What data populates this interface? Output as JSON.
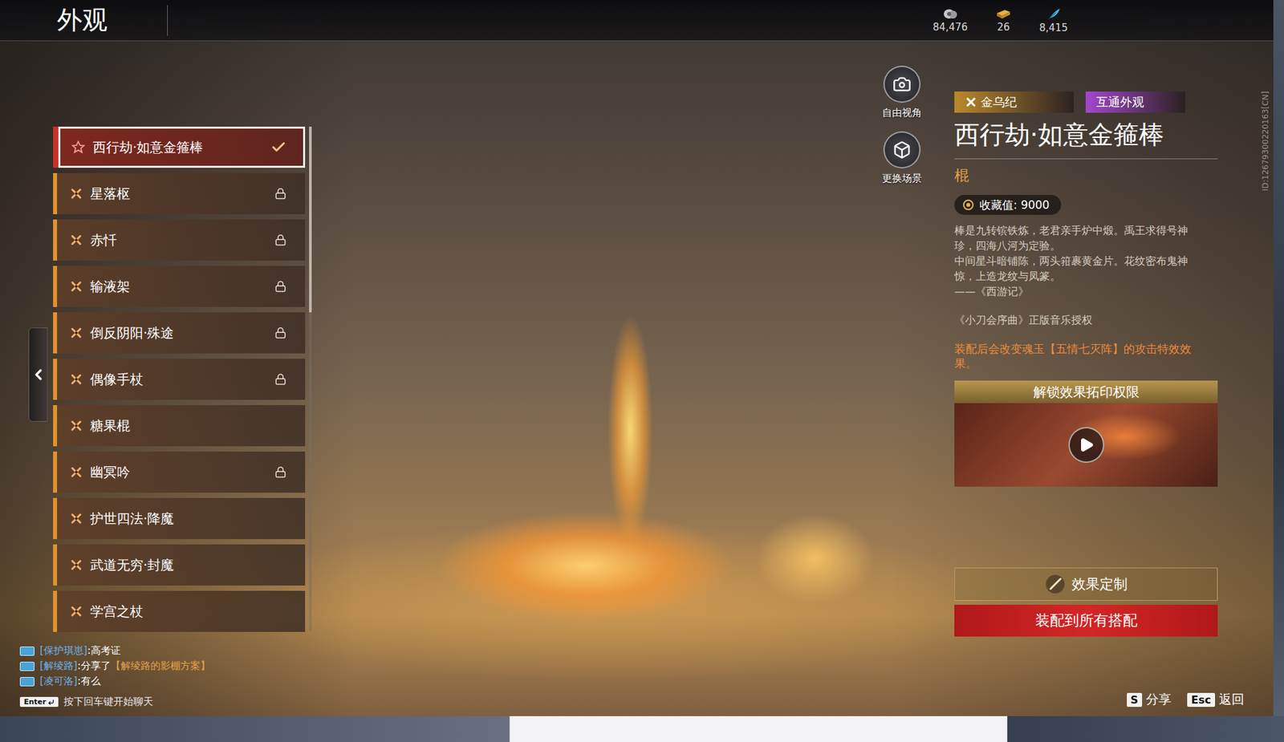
{
  "header": {
    "title": "外观",
    "currencies": [
      {
        "kind": "coin",
        "value": "84,476"
      },
      {
        "kind": "ticket",
        "value": "26"
      },
      {
        "kind": "feather",
        "value": "8,415"
      }
    ]
  },
  "skins": [
    {
      "name": "西行劫·如意金箍棒",
      "selected": true,
      "locked": false
    },
    {
      "name": "星落枢",
      "selected": false,
      "locked": true
    },
    {
      "name": "赤忏",
      "selected": false,
      "locked": true
    },
    {
      "name": "输液架",
      "selected": false,
      "locked": true
    },
    {
      "name": "倒反阴阳·殊途",
      "selected": false,
      "locked": true
    },
    {
      "name": "偶像手杖",
      "selected": false,
      "locked": true
    },
    {
      "name": "糖果棍",
      "selected": false,
      "locked": false
    },
    {
      "name": "幽冥吟",
      "selected": false,
      "locked": true
    },
    {
      "name": "护世四法·降魔",
      "selected": false,
      "locked": false
    },
    {
      "name": "武道无穷·封魔",
      "selected": false,
      "locked": false
    },
    {
      "name": "学宫之杖",
      "selected": false,
      "locked": false
    }
  ],
  "view_buttons": [
    {
      "kind": "camera",
      "label": "自由视角"
    },
    {
      "kind": "scene",
      "label": "更换场景"
    }
  ],
  "detail": {
    "tags": [
      {
        "label": "金乌纪",
        "color": "#b8862b"
      },
      {
        "label": "互通外观",
        "color": "#a046c8"
      }
    ],
    "title": "西行劫·如意金箍棒",
    "type": "棍",
    "collect": "收藏值: 9000",
    "description": [
      "棒是九转镔铁炼，老君亲手炉中煅。禹王求得号神",
      "珍，四海八河为定验。",
      "中间星斗暗铺陈，两头箝裹黄金片。花纹密布鬼神",
      "惊，上造龙纹与凤篆。",
      "——《西游记》"
    ],
    "music": "《小刀会序曲》正版音乐授权",
    "effect_note": [
      "装配后会改变魂玉【五情七灭阵】的攻击特效效",
      "果。"
    ],
    "unlock_title": "解锁效果拓印权限",
    "customize": "效果定制",
    "equip_all": "装配到所有搭配"
  },
  "id_text": "ID:12679300220163[CN]",
  "chat": {
    "messages": [
      {
        "name": "[保护琪崽]",
        "text": ":高考证",
        "link": ""
      },
      {
        "name": "[解绫路]",
        "text": ":分享了",
        "link": "【解绫路的影棚方案】"
      },
      {
        "name": "[凌可洛]",
        "text": ":有么",
        "link": ""
      }
    ],
    "hint_key": "Enter",
    "hint": "按下回车键开始聊天"
  },
  "shortcuts": [
    {
      "key": "S",
      "label": "分享"
    },
    {
      "key": "Esc",
      "label": "返回"
    }
  ]
}
